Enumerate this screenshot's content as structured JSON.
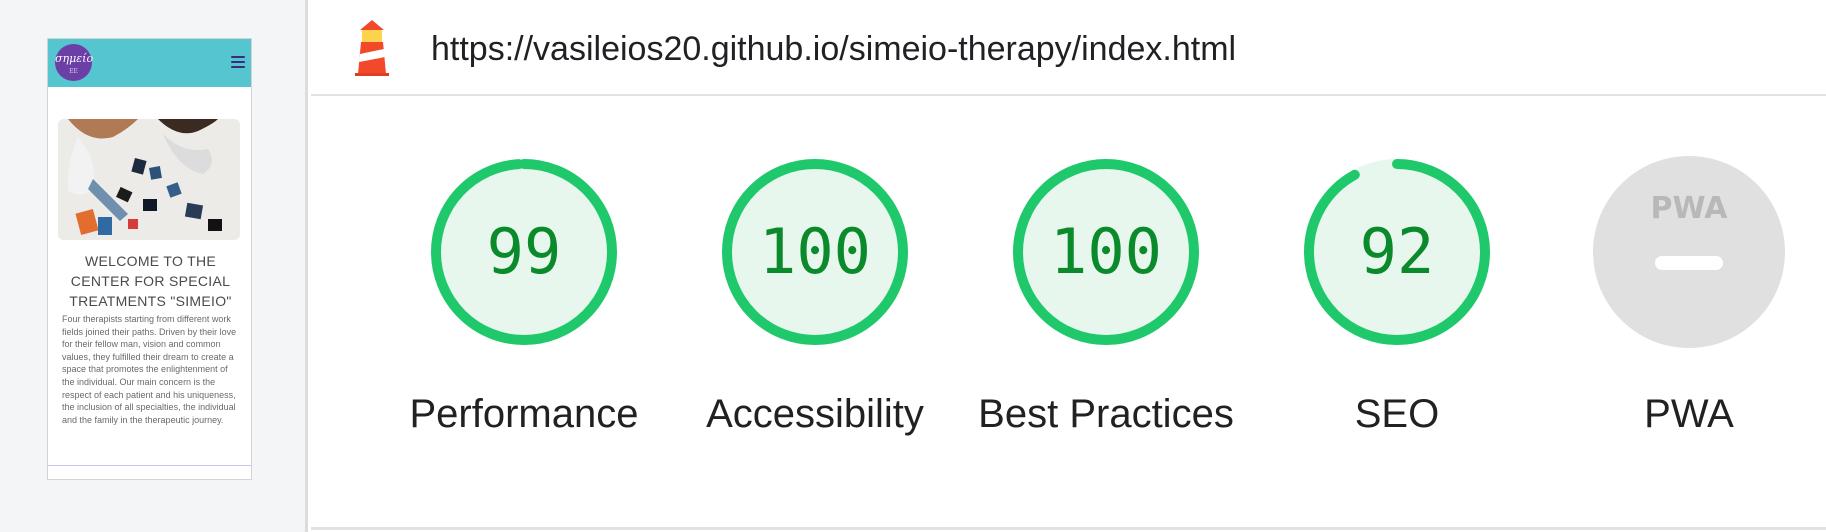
{
  "phone_preview": {
    "logo_text": "σημείο",
    "logo_sub": "EE",
    "title": "WELCOME TO THE CENTER FOR SPECIAL TREATMENTS \"SIMEIO\"",
    "body": "Four therapists starting from different work fields joined their paths. Driven by their love for their fellow man, vision and common values, they fulfilled their dream to create a space that promotes the enlightenment of the individual. Our main concern is the respect of each patient and his uniqueness, the inclusion of all specialties, the individual and the family in the therapeutic journey."
  },
  "report": {
    "url": "https://vasileios20.github.io/simeio-therapy/index.html",
    "gauges": [
      {
        "id": "performance",
        "score": "99",
        "value": 0.99,
        "label": "Performance",
        "color": "#1fc96b"
      },
      {
        "id": "accessibility",
        "score": "100",
        "value": 1.0,
        "label": "Accessibility",
        "color": "#1fc96b"
      },
      {
        "id": "best-practices",
        "score": "100",
        "value": 1.0,
        "label": "Best Practices",
        "color": "#1fc96b"
      },
      {
        "id": "seo",
        "score": "92",
        "value": 0.92,
        "label": "SEO",
        "color": "#1fc96b"
      }
    ],
    "pwa": {
      "label": "PWA",
      "badge": "PWA"
    }
  },
  "colors": {
    "pass": "#1fc96b",
    "pass_fill": "#e8f7ee",
    "pass_text": "#0a8a2b",
    "pwa_gray": "#e0e0e0",
    "header_teal": "#55c5cf",
    "logo_purple": "#6b3fa6"
  }
}
